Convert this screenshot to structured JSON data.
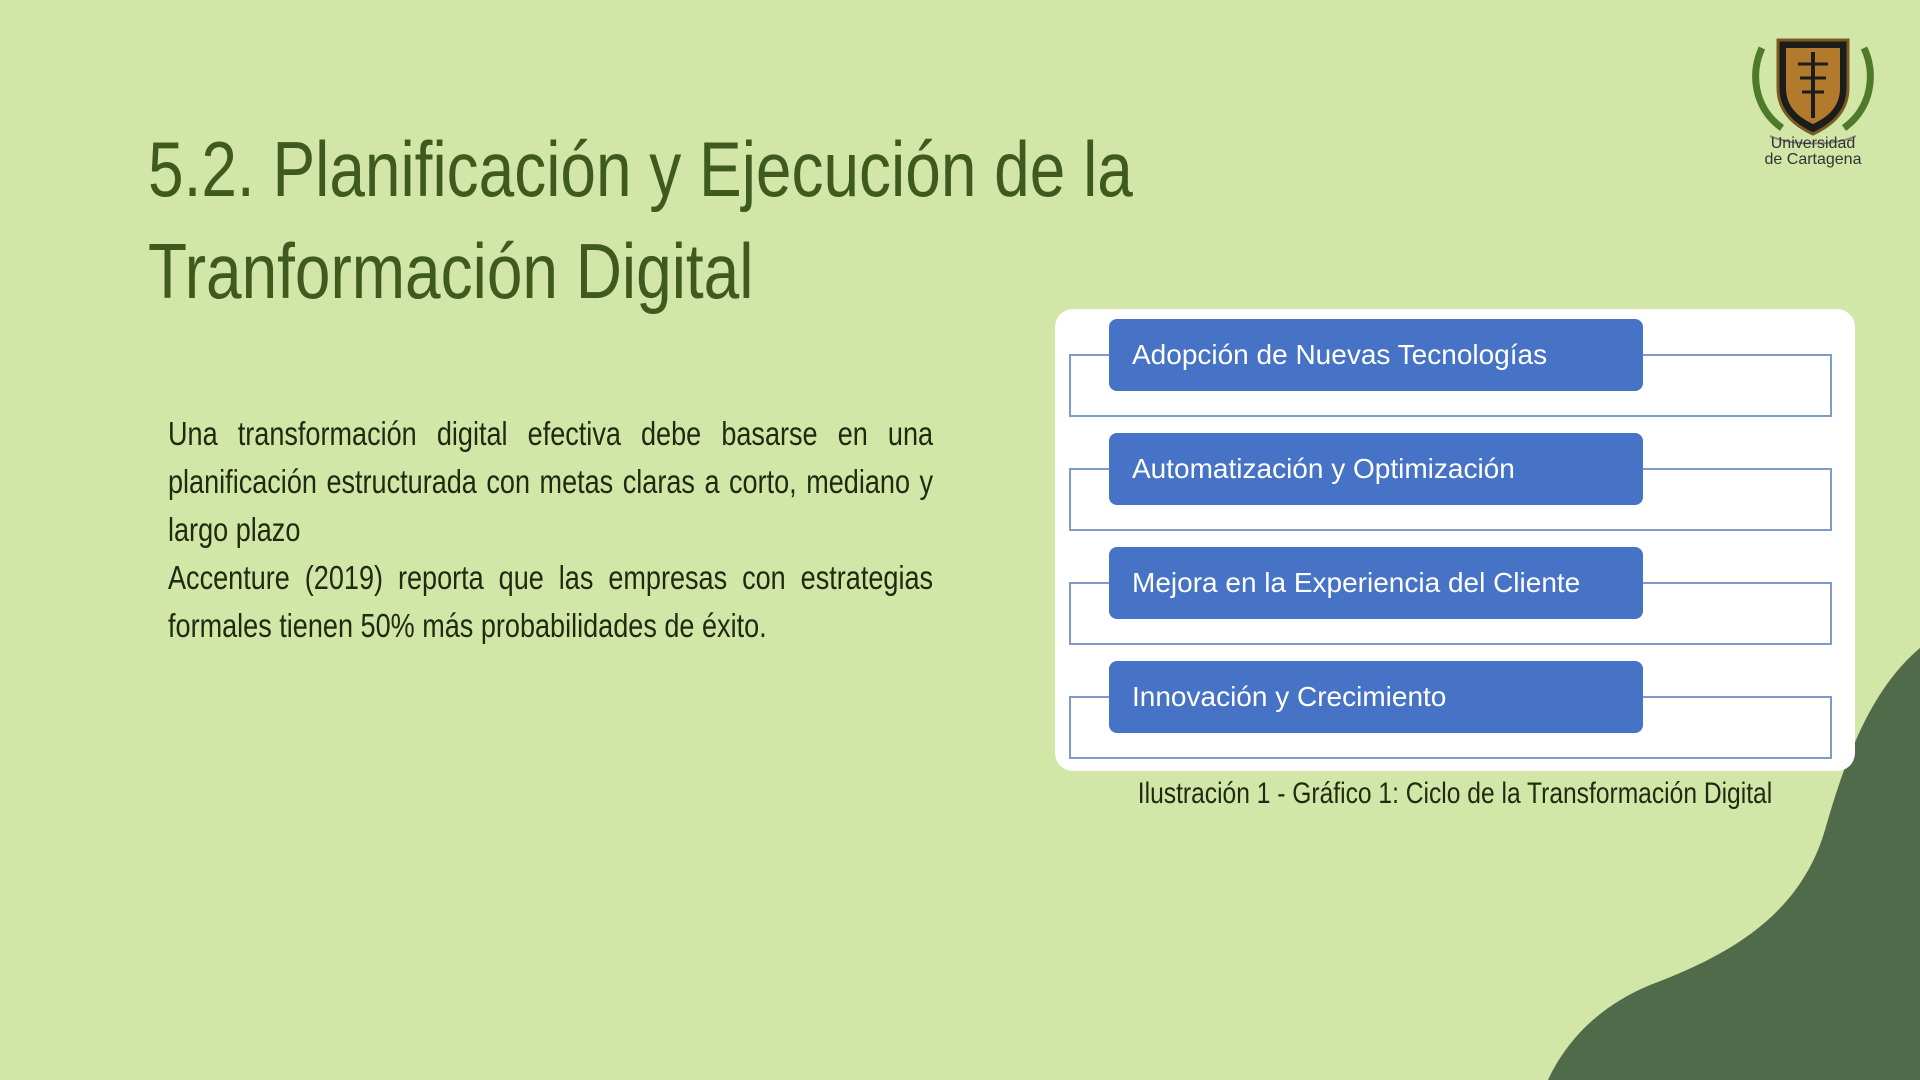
{
  "slide": {
    "title_line1": "5.2. Planificación y Ejecución de la",
    "title_line2": "Tranformación Digital",
    "paragraph1": "Una transformación digital efectiva debe basarse en una planificación estructurada con metas claras a corto, mediano y largo plazo",
    "paragraph2": "Accenture (2019) reporta que las empresas con estrategias formales tienen 50% más probabilidades de éxito."
  },
  "logo": {
    "line1": "Universidad",
    "line2": "de Cartagena",
    "icon": "university-crest-icon"
  },
  "figure": {
    "steps": [
      "Adopción de Nuevas Tecnologías",
      "Automatización y Optimización",
      "Mejora en la Experiencia del Cliente",
      "Innovación y Crecimiento"
    ],
    "caption": "Ilustración 1 - Gráfico 1: Ciclo de la Transformación Digital"
  },
  "colors": {
    "background": "#d1e6a7",
    "title": "#3f5a1f",
    "step_box": "#4673c5",
    "corner_shape": "#506b49"
  }
}
